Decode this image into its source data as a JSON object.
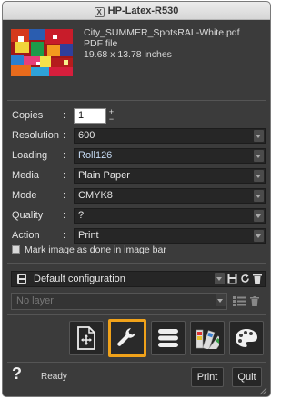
{
  "window": {
    "title": "HP-Latex-R530",
    "title_icon": "X"
  },
  "file": {
    "name": "City_SUMMER_SpotsRAL-White.pdf",
    "type": "PDF file",
    "size": "19.68 x 13.78 inches"
  },
  "settings": {
    "copies": {
      "label": "Copies",
      "value": "1"
    },
    "resolution": {
      "label": "Resolution",
      "value": "600"
    },
    "loading": {
      "label": "Loading",
      "value": "Roll126"
    },
    "media": {
      "label": "Media",
      "value": "Plain Paper"
    },
    "mode": {
      "label": "Mode",
      "value": "CMYK8"
    },
    "quality": {
      "label": "Quality",
      "value": "?"
    },
    "action": {
      "label": "Action",
      "value": "Print"
    },
    "colon": ":"
  },
  "mark_done": {
    "label": "Mark image as done in image bar",
    "checked": false
  },
  "configuration": {
    "value": "Default configuration"
  },
  "layer": {
    "placeholder": "No layer"
  },
  "toolbar": {
    "buttons": [
      {
        "icon": "document-move-icon",
        "active": false
      },
      {
        "icon": "wrench-icon",
        "active": true
      },
      {
        "icon": "stack-icon",
        "active": false
      },
      {
        "icon": "color-swatches-icon",
        "active": false
      },
      {
        "icon": "palette-icon",
        "active": false
      }
    ],
    "accent_color": "#f0a21a"
  },
  "footer": {
    "help": "?",
    "status": "Ready",
    "print_label": "Print",
    "quit_label": "Quit"
  }
}
